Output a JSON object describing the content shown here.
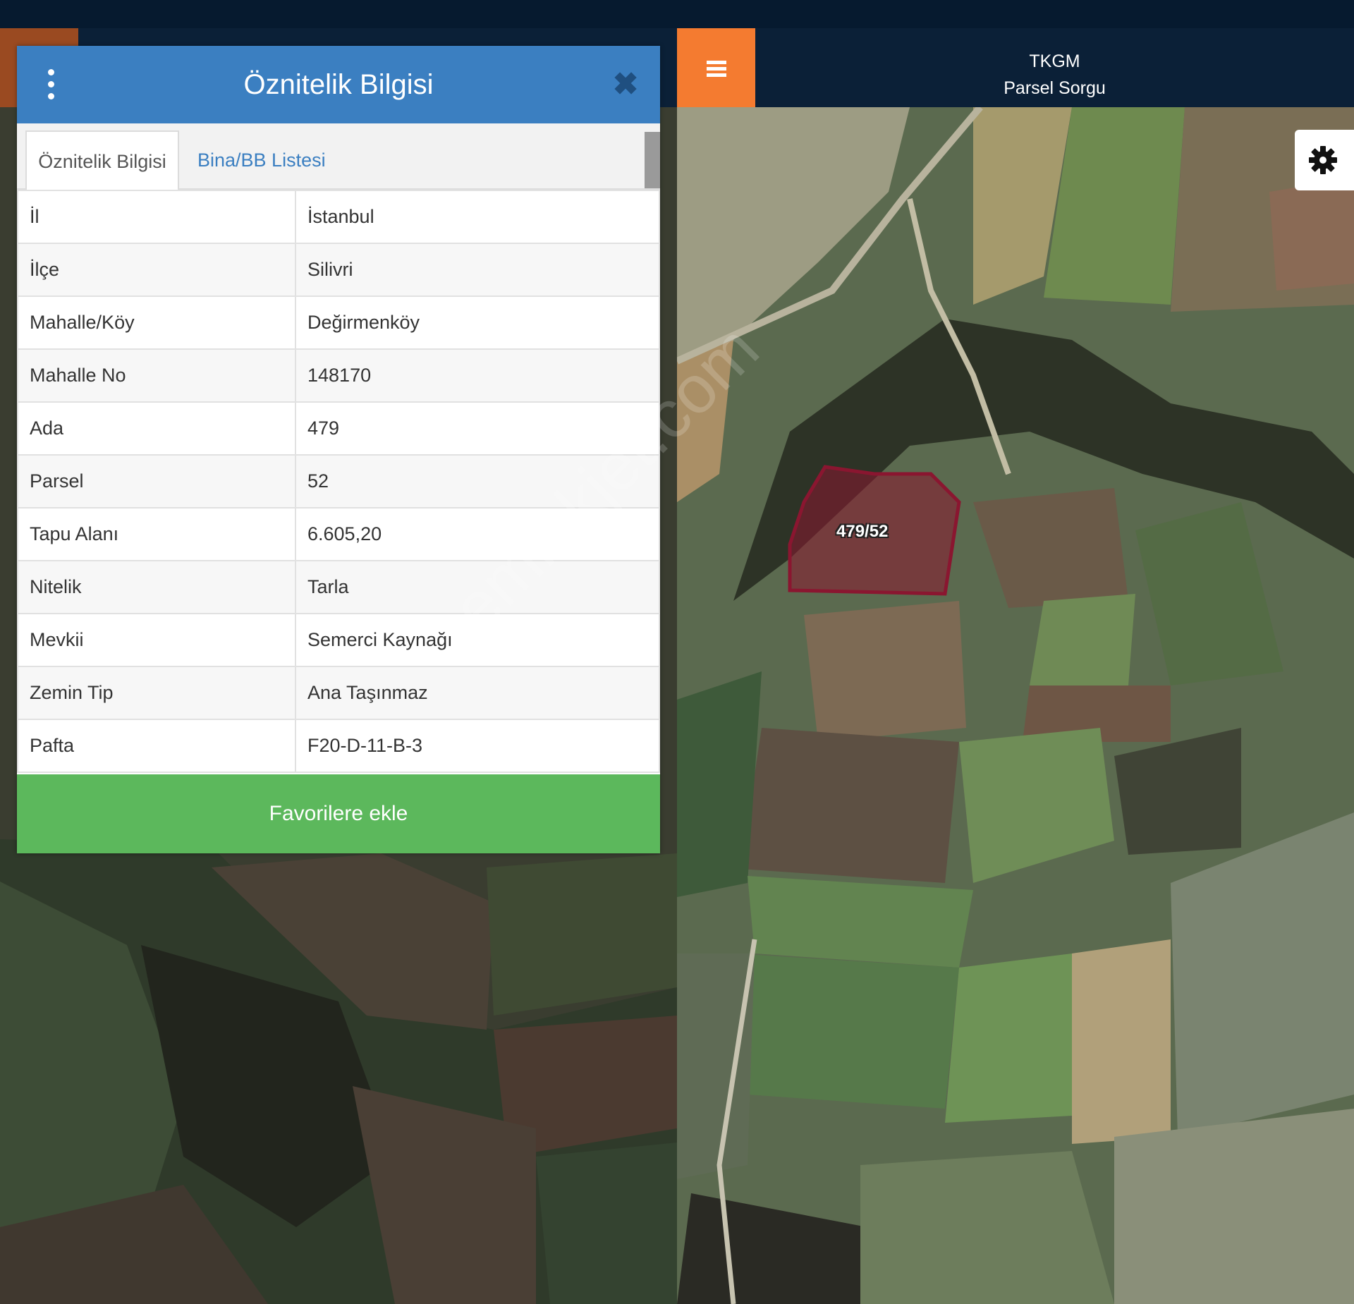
{
  "app_header": {
    "line1": "TKGM",
    "line2": "Parsel Sorgu"
  },
  "dialog": {
    "title": "Öznitelik Bilgisi",
    "tabs": [
      {
        "label": "Öznitelik Bilgisi",
        "active": true
      },
      {
        "label": "Bina/BB Listesi",
        "active": false
      }
    ],
    "rows": [
      {
        "key": "İl",
        "value": "İstanbul"
      },
      {
        "key": "İlçe",
        "value": "Silivri"
      },
      {
        "key": "Mahalle/Köy",
        "value": "Değirmenköy"
      },
      {
        "key": "Mahalle No",
        "value": "148170"
      },
      {
        "key": "Ada",
        "value": "479"
      },
      {
        "key": "Parsel",
        "value": "52"
      },
      {
        "key": "Tapu Alanı",
        "value": "6.605,20"
      },
      {
        "key": "Nitelik",
        "value": "Tarla"
      },
      {
        "key": "Mevkii",
        "value": "Semerci Kaynağı"
      },
      {
        "key": "Zemin Tip",
        "value": "Ana Taşınmaz"
      },
      {
        "key": "Pafta",
        "value": "F20-D-11-B-3"
      }
    ],
    "favorite_button": "Favorilere ekle"
  },
  "map": {
    "parcel_label": "479/52"
  },
  "watermark": "emlakjet.com",
  "icons": {
    "kebab": "kebab-menu-icon",
    "close": "close-icon",
    "menu": "hamburger-icon",
    "settings": "gear-icon"
  },
  "colors": {
    "dialog_header": "#3b7fc1",
    "favorite_button": "#5cb85c",
    "menu_button": "#f47b30",
    "app_header": "#0b2037",
    "parcel_outline": "#8a1630"
  }
}
